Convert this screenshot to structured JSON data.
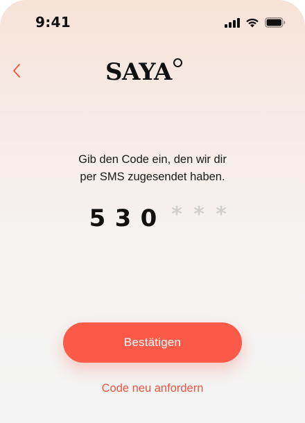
{
  "status_bar": {
    "time": "9:41",
    "icons": [
      "cellular-signal-icon",
      "wifi-icon",
      "battery-icon"
    ]
  },
  "header": {
    "back_icon": "chevron-left-icon",
    "logo_text": "SAYA",
    "logo_ring": "ring-icon"
  },
  "verification": {
    "instruction_line1": "Gib den Code ein, den wir dir",
    "instruction_line2": "per SMS zugesendet haben.",
    "digits": [
      "5",
      "3",
      "0"
    ],
    "masked": [
      "*",
      "*",
      "*"
    ]
  },
  "actions": {
    "confirm_label": "Bestätigen",
    "resend_label": "Code neu anfordern"
  },
  "colors": {
    "accent": "#fa5a47",
    "link": "#f0533f",
    "text": "#111111",
    "placeholder": "#cfcfcf"
  }
}
